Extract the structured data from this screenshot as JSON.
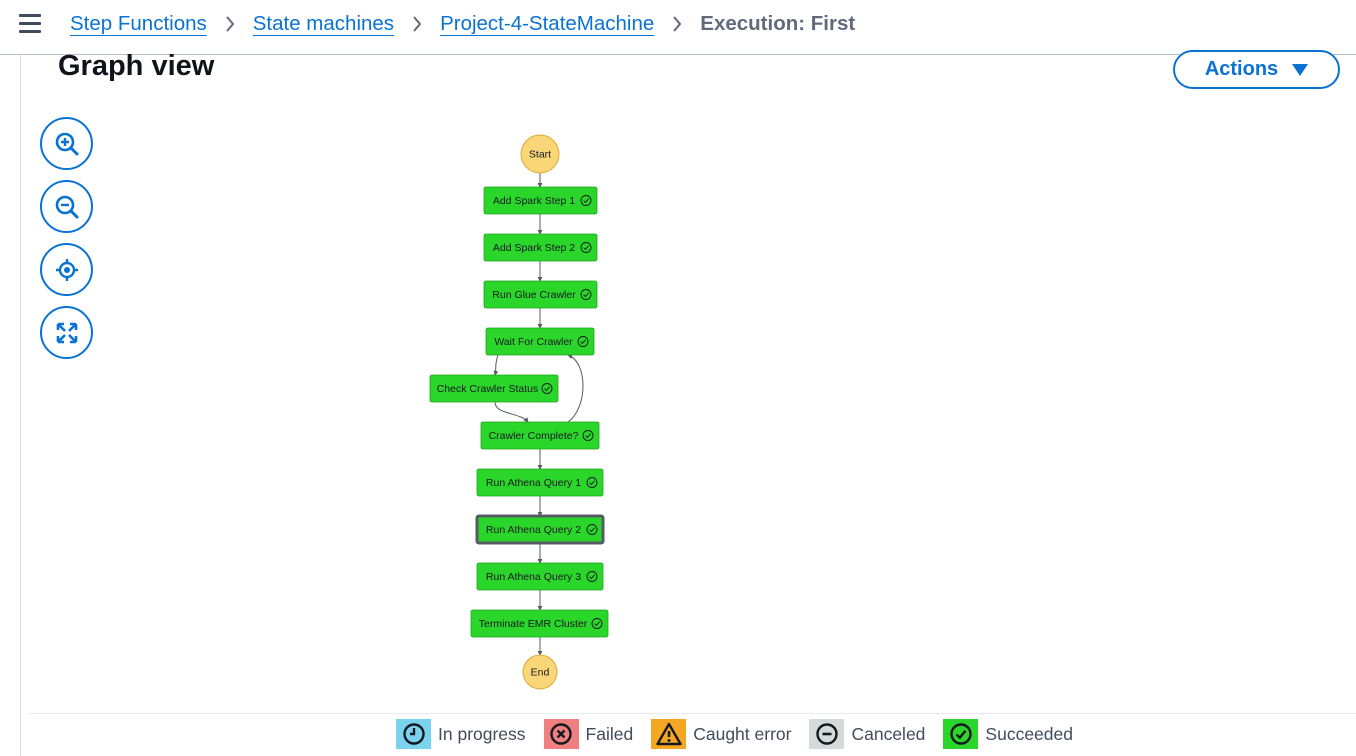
{
  "breadcrumb": {
    "items": [
      "Step Functions",
      "State machines",
      "Project-4-StateMachine"
    ],
    "current": "Execution: First"
  },
  "header": {
    "title": "Graph view",
    "actions_label": "Actions"
  },
  "zoom_controls": [
    "zoom-in-icon",
    "zoom-out-icon",
    "center-icon",
    "fit-to-screen-icon"
  ],
  "graph": {
    "start_label": "Start",
    "end_label": "End",
    "states": [
      {
        "name": "Add Spark Step 1",
        "status": "Succeeded"
      },
      {
        "name": "Add Spark Step 2",
        "status": "Succeeded"
      },
      {
        "name": "Run Glue Crawler",
        "status": "Succeeded"
      },
      {
        "name": "Wait For Crawler",
        "status": "Succeeded"
      },
      {
        "name": "Check Crawler Status",
        "status": "Succeeded"
      },
      {
        "name": "Crawler Complete?",
        "status": "Succeeded"
      },
      {
        "name": "Run Athena Query 1",
        "status": "Succeeded"
      },
      {
        "name": "Run Athena Query 2",
        "status": "Succeeded",
        "selected": true
      },
      {
        "name": "Run Athena Query 3",
        "status": "Succeeded"
      },
      {
        "name": "Terminate EMR Cluster",
        "status": "Succeeded"
      }
    ],
    "colors": {
      "succeeded": "#2bd62b",
      "terminal": "#f9d677",
      "edge": "#545b64"
    }
  },
  "legend": [
    {
      "label": "In progress",
      "icon": "clock-icon",
      "color": "#7ad3ee"
    },
    {
      "label": "Failed",
      "icon": "x-circle-icon",
      "color": "#f08080"
    },
    {
      "label": "Caught error",
      "icon": "warning-icon",
      "color": "#f5a623"
    },
    {
      "label": "Canceled",
      "icon": "minus-circle-icon",
      "color": "#d5dbdb"
    },
    {
      "label": "Succeeded",
      "icon": "check-circle-icon",
      "color": "#2bd62b"
    }
  ]
}
